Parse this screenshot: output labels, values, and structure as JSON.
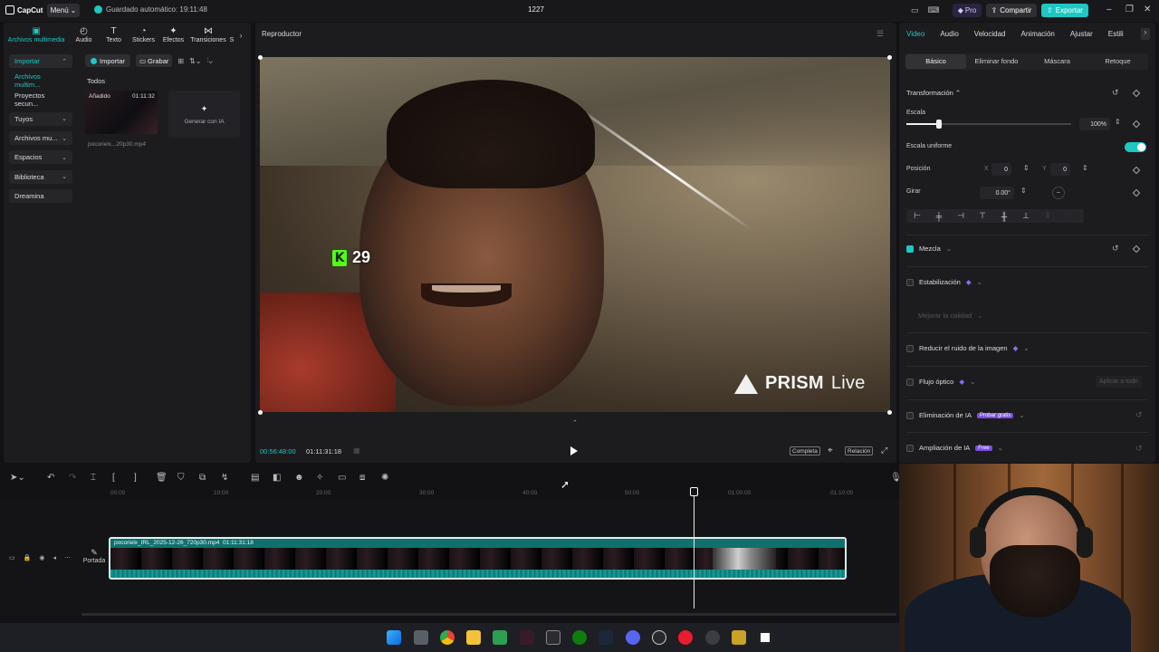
{
  "app": {
    "logo": "CapCut",
    "menu": "Menú",
    "autosave": "Guardado automático: 19:11:48",
    "project_title": "1227",
    "pro": "Pro",
    "share": "Compartir",
    "export": "Exportar",
    "accent": "#1fc7c3"
  },
  "left": {
    "tools": [
      "Archivos multimedia",
      "Audio",
      "Texto",
      "Stickers",
      "Efectos",
      "Transiciones",
      "S"
    ],
    "nav": [
      "Importar",
      "Archivos multim...",
      "Proyectos secun...",
      "Tuyos",
      "Archivos mu...",
      "Espacios",
      "Biblioteca",
      "Dreamina"
    ],
    "import_btn": "Importar",
    "record_btn": "Grabar",
    "todos": "Todos",
    "thumb_added": "Añadido",
    "thumb_duration": "01:11:32",
    "thumb_name": "pocorielx...20p30.mp4",
    "gen_ia": "Generar con IA"
  },
  "player": {
    "title": "Reproductor",
    "current_time": "00:56:48:00",
    "total_time": "01:11:31:18",
    "full_btn": "Completa",
    "ratio_btn": "Relación",
    "overlay_count": "29",
    "overlay_k": "K",
    "watermark_word1": "PRISM",
    "watermark_word2": "Live"
  },
  "right": {
    "tabs": [
      "Video",
      "Audio",
      "Velocidad",
      "Animación",
      "Ajustar",
      "Estili"
    ],
    "subtabs": [
      "Básico",
      "Eliminar fondo",
      "Máscara",
      "Retoque"
    ],
    "transform": "Transformación",
    "scale": "Escala",
    "scale_value": "100%",
    "scale_level": 0.2,
    "uniform_scale": "Escala uniforme",
    "position": "Posición",
    "pos_x_label": "X",
    "pos_x": "0",
    "pos_y_label": "Y",
    "pos_y": "0",
    "rotate": "Girar",
    "rotate_value": "0.00°",
    "blend": "Mezcla",
    "stabilization": "Estabilización",
    "improve_quality": "Mejorar la calidad",
    "noise_reduction": "Reducir el ruido de la imagen",
    "optical_flow": "Flujo óptico",
    "apply_all": "Aplicar a todo",
    "ai_removal": "Eliminación de IA",
    "try_free": "Probar gratis",
    "ai_upscale": "Ampliación de IA",
    "free": "Free"
  },
  "timeline": {
    "ruler": [
      "00:00",
      "10:00",
      "20:00",
      "30:00",
      "40:00",
      "50:00",
      "01:00:00",
      "01:10:00"
    ],
    "cover": "Portada",
    "clip_label": "pocorielx_IRL_2025-12-26_720p30.mp4",
    "clip_duration": "01:11:31:18"
  }
}
